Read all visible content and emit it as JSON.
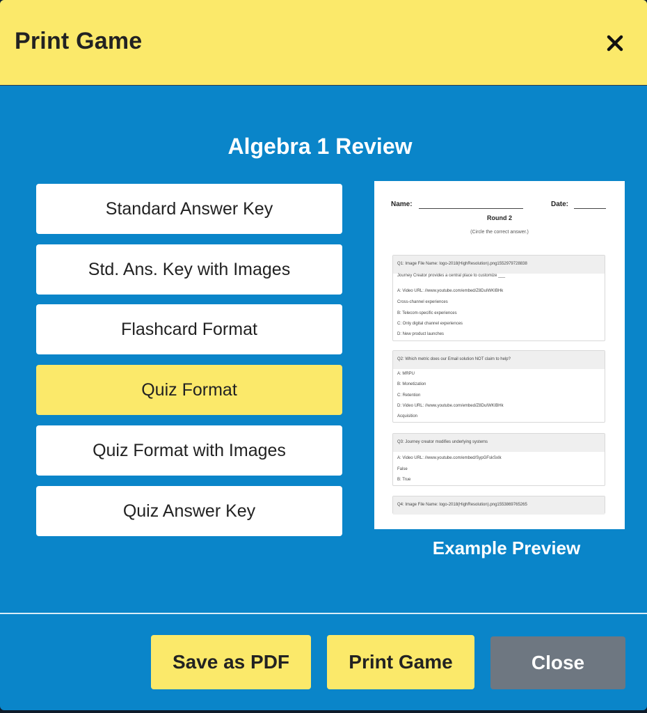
{
  "header": {
    "title": "Print Game"
  },
  "game": {
    "title": "Algebra 1 Review"
  },
  "options": [
    {
      "label": "Standard Answer Key",
      "selected": false
    },
    {
      "label": "Std. Ans. Key with Images",
      "selected": false
    },
    {
      "label": "Flashcard Format",
      "selected": false
    },
    {
      "label": "Quiz Format",
      "selected": true
    },
    {
      "label": "Quiz Format with Images",
      "selected": false
    },
    {
      "label": "Quiz Answer Key",
      "selected": false
    }
  ],
  "preview": {
    "caption": "Example Preview",
    "name_label": "Name:",
    "date_label": "Date:",
    "round": "Round 2",
    "instructions": "(Circle the correct answer.)",
    "questions": [
      {
        "head": "Q1:   Image File Name: logo-2018(HighResolution).png1552979728838",
        "lines": [
          "Journey Creator provides a central place to customize ___",
          "A:   Video URL: //www.youtube.com/embed/Z8DuIWKIBHk",
          "Cross-channel experiences",
          "B:   Telecom-specific experiences",
          "C:   Only digital channel experiences",
          "D:   New product launches"
        ]
      },
      {
        "head": "Q2:   Which metric does our Email solution NOT claim to help?",
        "lines": [
          "A:   MRPU",
          "B:   Monetization",
          "C:   Retention",
          "D:   Video URL: //www.youtube.com/embed/Z8DuIWKIBHk",
          "Acquisition"
        ]
      },
      {
        "head": "Q3:   Journey creator modifies underlying systems",
        "lines": [
          "A:   Video URL: //www.youtube.com/embed/SypGFskSxIk",
          "False",
          "B:   True"
        ]
      },
      {
        "head": "Q4:   Image File Name: logo-2018(HighResolution).png1553869765265",
        "lines": []
      }
    ]
  },
  "footer": {
    "save_pdf": "Save as PDF",
    "print_game": "Print Game",
    "close": "Close"
  },
  "colors": {
    "accent_yellow": "#fbe96a",
    "background_blue": "#0a85c9",
    "close_gray": "#6e7781"
  }
}
